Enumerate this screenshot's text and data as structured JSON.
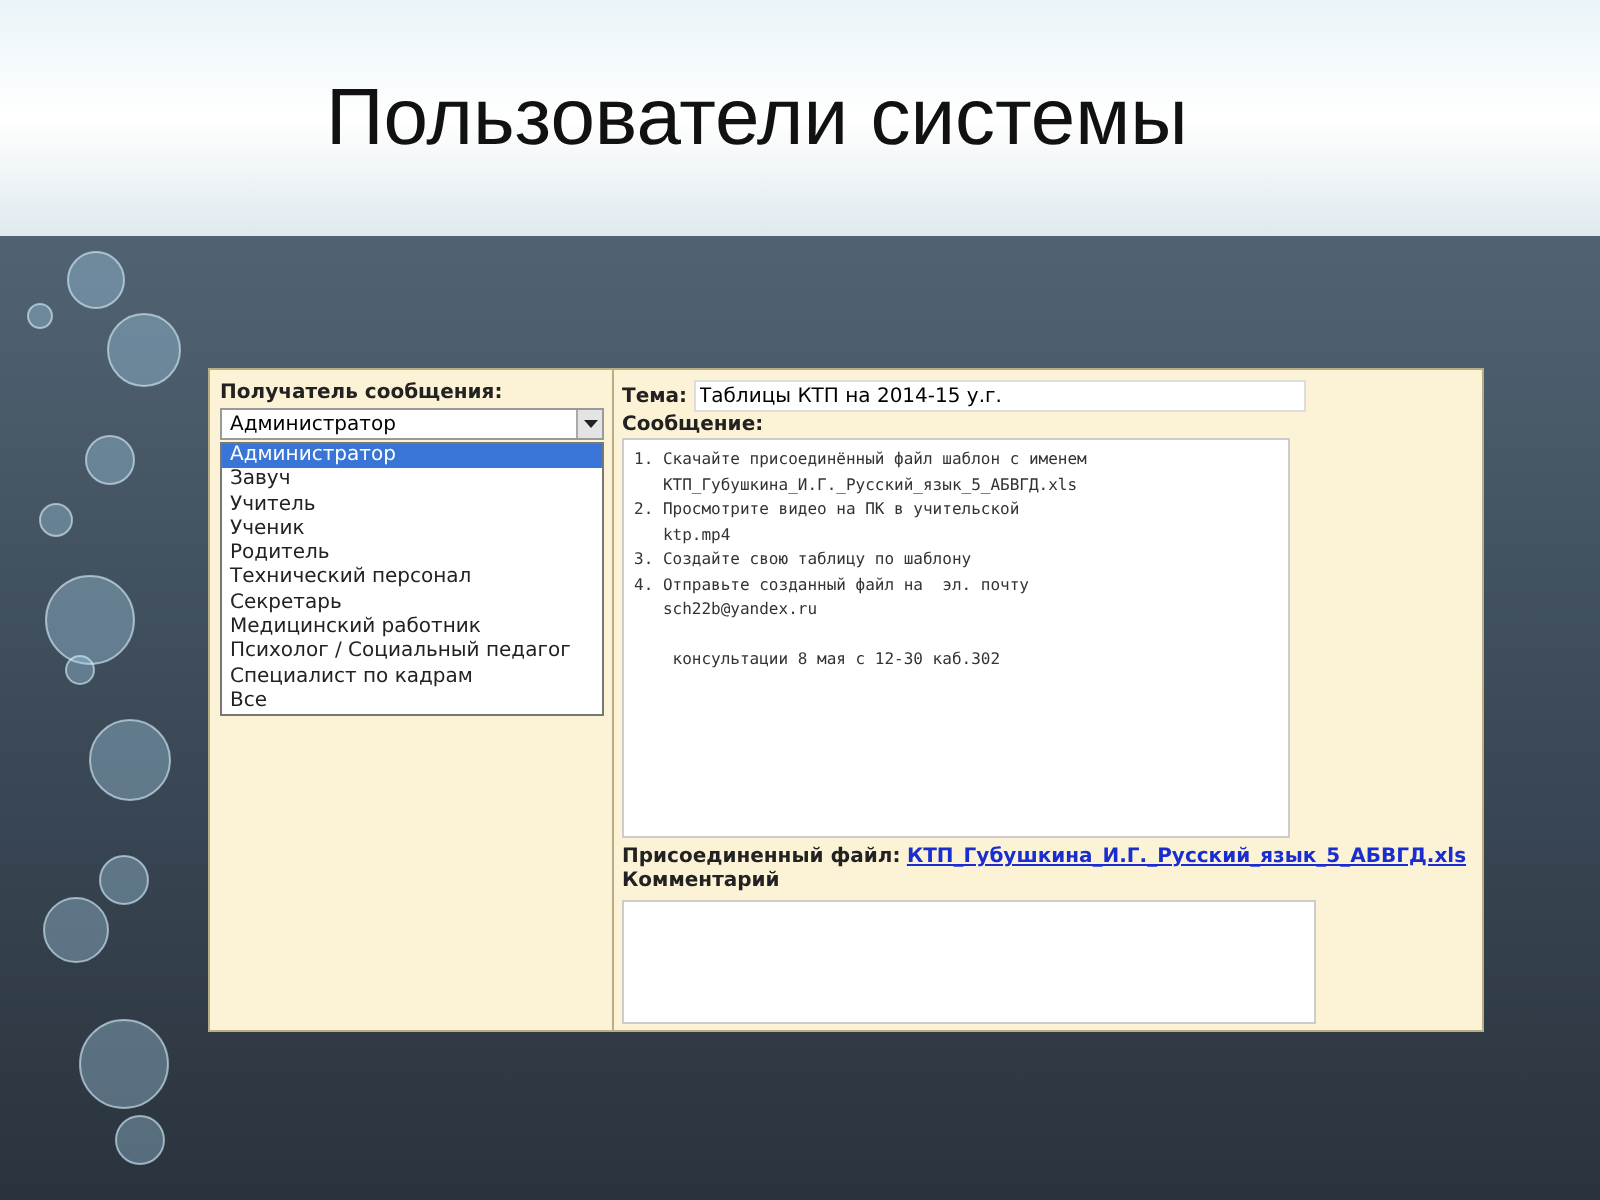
{
  "slide": {
    "title": "Пользователи системы"
  },
  "form": {
    "recipient_label": "Получатель сообщения:",
    "recipient_value": "Администратор",
    "recipient_options": [
      {
        "label": "Администратор",
        "selected": true
      },
      {
        "label": "Завуч",
        "selected": false
      },
      {
        "label": "Учитель",
        "selected": false
      },
      {
        "label": "Ученик",
        "selected": false
      },
      {
        "label": "Родитель",
        "selected": false
      },
      {
        "label": "Технический персонал",
        "selected": false
      },
      {
        "label": "Секретарь",
        "selected": false
      },
      {
        "label": "Медицинский работник",
        "selected": false
      },
      {
        "label": "Психолог / Социальный педагог",
        "selected": false
      },
      {
        "label": "Специалист по кадрам",
        "selected": false
      },
      {
        "label": "Все",
        "selected": false
      }
    ],
    "subject_label": "Тема:",
    "subject_value": "Таблицы КТП на 2014-15 у.г.",
    "message_label": "Сообщение:",
    "message_value": "1. Скачайте присоединённый файл шаблон с именем\n   КТП_Губушкина_И.Г._Русский_язык_5_АБВГД.xls\n2. Просмотрите видео на ПК в учительской\n   ktp.mp4\n3. Создайте свою таблицу по шаблону\n4. Отправьте созданный файл на  эл. почту\n   sch22b@yandex.ru\n\n    консультации 8 мая с 12-30 каб.302",
    "attachment_label": "Присоединенный файл:",
    "attachment_link": "КТП_Губушкина_И.Г._Русский_язык_5_АБВГД.xls",
    "comment_label": "Комментарий"
  }
}
